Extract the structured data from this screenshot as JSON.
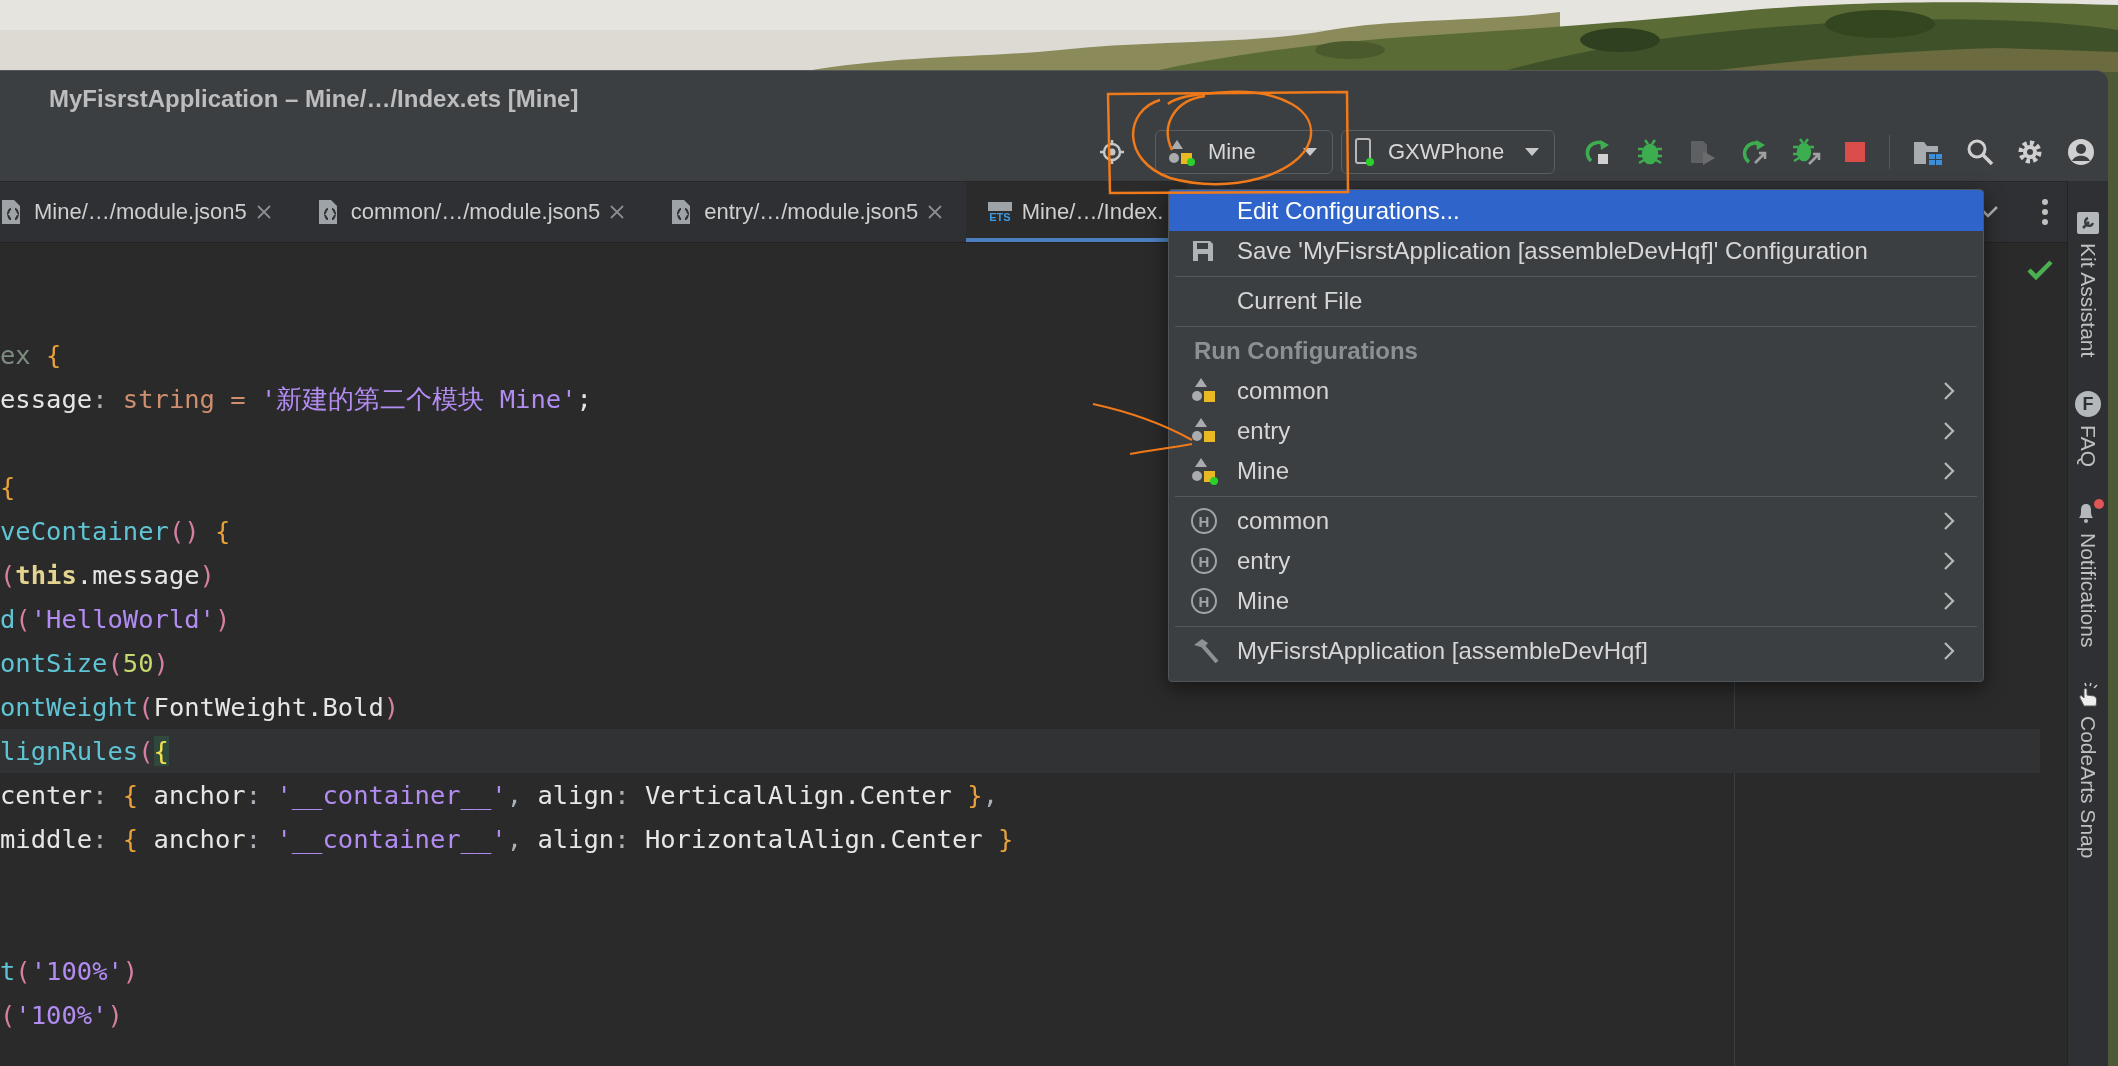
{
  "window": {
    "title": "MyFisrstApplication – Mine/…/Index.ets [Mine]"
  },
  "toolbar": {
    "run_config": {
      "label": "Mine",
      "active": true
    },
    "device": {
      "label": "GXWPhone",
      "connected": true
    },
    "actions": [
      {
        "kind": "run",
        "disabled": false
      },
      {
        "kind": "debug",
        "disabled": false
      },
      {
        "kind": "attach",
        "disabled": true
      },
      {
        "kind": "rerun",
        "disabled": false
      },
      {
        "kind": "profile",
        "disabled": false
      },
      {
        "kind": "stop",
        "disabled": false
      }
    ],
    "tools": [
      {
        "kind": "project"
      },
      {
        "kind": "search"
      },
      {
        "kind": "settings"
      },
      {
        "kind": "account"
      }
    ]
  },
  "tabs": [
    {
      "label": "Mine/…/module.json5",
      "kind": "json",
      "closable": true,
      "selected": false
    },
    {
      "label": "common/…/module.json5",
      "kind": "json",
      "closable": true,
      "selected": false
    },
    {
      "label": "entry/…/module.json5",
      "kind": "json",
      "closable": true,
      "selected": false
    },
    {
      "label": "Mine/…/Index.",
      "kind": "ets",
      "badge": "ETS",
      "closable": false,
      "selected": true
    }
  ],
  "editor": {
    "lines": [
      {
        "kind": "code",
        "current": false,
        "tokens": [
          {
            "text": "ex ",
            "kind": "dim"
          },
          {
            "text": "{",
            "kind": "brace"
          }
        ]
      },
      {
        "kind": "code",
        "current": false,
        "tokens": [
          {
            "text": "essage",
            "kind": "plain"
          },
          {
            "text": ": ",
            "kind": "punct"
          },
          {
            "text": "string ",
            "kind": "keyword"
          },
          {
            "text": "= ",
            "kind": "keyword"
          },
          {
            "text": "'新建的第二个模块 Mine'",
            "kind": "string"
          },
          {
            "text": ";",
            "kind": "plain"
          }
        ]
      },
      {
        "kind": "blank"
      },
      {
        "kind": "code",
        "current": false,
        "tokens": [
          {
            "text": "{",
            "kind": "brace"
          }
        ]
      },
      {
        "kind": "code",
        "current": false,
        "tokens": [
          {
            "text": "veContainer",
            "kind": "func"
          },
          {
            "text": "() ",
            "kind": "paren"
          },
          {
            "text": "{",
            "kind": "brace"
          }
        ]
      },
      {
        "kind": "code",
        "current": false,
        "tokens": [
          {
            "text": "(",
            "kind": "paren"
          },
          {
            "text": "this",
            "kind": "this"
          },
          {
            "text": ".message",
            "kind": "plain"
          },
          {
            "text": ")",
            "kind": "paren"
          }
        ]
      },
      {
        "kind": "code",
        "current": false,
        "tokens": [
          {
            "text": "d",
            "kind": "func"
          },
          {
            "text": "(",
            "kind": "paren"
          },
          {
            "text": "'HelloWorld'",
            "kind": "string"
          },
          {
            "text": ")",
            "kind": "paren"
          }
        ]
      },
      {
        "kind": "code",
        "current": false,
        "tokens": [
          {
            "text": "ontSize",
            "kind": "func"
          },
          {
            "text": "(",
            "kind": "paren"
          },
          {
            "text": "50",
            "kind": "number"
          },
          {
            "text": ")",
            "kind": "paren"
          }
        ]
      },
      {
        "kind": "code",
        "current": false,
        "tokens": [
          {
            "text": "ontWeight",
            "kind": "func"
          },
          {
            "text": "(",
            "kind": "paren"
          },
          {
            "text": "FontWeight.Bold",
            "kind": "plain"
          },
          {
            "text": ")",
            "kind": "paren"
          }
        ]
      },
      {
        "kind": "code",
        "current": true,
        "tokens": [
          {
            "text": "lignRules",
            "kind": "func"
          },
          {
            "text": "(",
            "kind": "paren"
          },
          {
            "text": "{",
            "kind": "hlbrace"
          }
        ]
      },
      {
        "kind": "code",
        "current": false,
        "tokens": [
          {
            "text": "center",
            "kind": "plain"
          },
          {
            "text": ": ",
            "kind": "punct"
          },
          {
            "text": "{",
            "kind": "brace"
          },
          {
            "text": " anchor",
            "kind": "plain"
          },
          {
            "text": ": ",
            "kind": "punct"
          },
          {
            "text": "'__container__'",
            "kind": "string"
          },
          {
            "text": ", ",
            "kind": "punct"
          },
          {
            "text": "align",
            "kind": "plain"
          },
          {
            "text": ": ",
            "kind": "punct"
          },
          {
            "text": "VerticalAlign.Center ",
            "kind": "plain"
          },
          {
            "text": "}",
            "kind": "brace"
          },
          {
            "text": ",",
            "kind": "punct"
          }
        ]
      },
      {
        "kind": "code",
        "current": false,
        "tokens": [
          {
            "text": "middle",
            "kind": "plain"
          },
          {
            "text": ": ",
            "kind": "punct"
          },
          {
            "text": "{",
            "kind": "brace"
          },
          {
            "text": " anchor",
            "kind": "plain"
          },
          {
            "text": ": ",
            "kind": "punct"
          },
          {
            "text": "'__container__'",
            "kind": "string"
          },
          {
            "text": ", ",
            "kind": "punct"
          },
          {
            "text": "align",
            "kind": "plain"
          },
          {
            "text": ": ",
            "kind": "punct"
          },
          {
            "text": "HorizontalAlign.Center ",
            "kind": "plain"
          },
          {
            "text": "}",
            "kind": "brace"
          }
        ]
      },
      {
        "kind": "blank"
      },
      {
        "kind": "blank"
      },
      {
        "kind": "code",
        "current": false,
        "tokens": [
          {
            "text": "t",
            "kind": "func"
          },
          {
            "text": "(",
            "kind": "paren"
          },
          {
            "text": "'100%'",
            "kind": "string"
          },
          {
            "text": ")",
            "kind": "paren"
          }
        ]
      },
      {
        "kind": "code",
        "current": false,
        "tokens": [
          {
            "text": "(",
            "kind": "paren"
          },
          {
            "text": "'100%'",
            "kind": "string"
          },
          {
            "text": ")",
            "kind": "paren"
          }
        ]
      }
    ]
  },
  "menu": {
    "sections": [
      {
        "items": [
          {
            "label": "Edit Configurations...",
            "kind": "plain",
            "selected": true,
            "submenu": false
          },
          {
            "label": "Save 'MyFisrstApplication [assembleDevHqf]' Configuration",
            "kind": "save",
            "selected": false,
            "submenu": false
          }
        ]
      },
      {
        "items": [
          {
            "label": "Current File",
            "kind": "plain",
            "selected": false,
            "submenu": false
          }
        ]
      },
      {
        "header": "Run Configurations",
        "items": [
          {
            "label": "common",
            "kind": "module",
            "active": false,
            "selected": false,
            "submenu": true
          },
          {
            "label": "entry",
            "kind": "module",
            "active": false,
            "selected": false,
            "submenu": true
          },
          {
            "label": "Mine",
            "kind": "module",
            "active": true,
            "selected": false,
            "submenu": true
          }
        ]
      },
      {
        "items": [
          {
            "label": "common",
            "kind": "hvigor",
            "icon_letter": "H",
            "selected": false,
            "submenu": true
          },
          {
            "label": "entry",
            "kind": "hvigor",
            "icon_letter": "H",
            "selected": false,
            "submenu": true
          },
          {
            "label": "Mine",
            "kind": "hvigor",
            "icon_letter": "H",
            "selected": false,
            "submenu": true
          }
        ]
      },
      {
        "items": [
          {
            "label": "MyFisrstApplication [assembleDevHqf]",
            "kind": "task",
            "selected": false,
            "submenu": true
          }
        ]
      }
    ]
  },
  "sidebar": [
    {
      "label": "Kit Assistant",
      "kind": "kit",
      "alert": false
    },
    {
      "label": "FAQ",
      "kind": "letter",
      "icon_letter": "F",
      "alert": false
    },
    {
      "label": "Notifications",
      "kind": "bell",
      "alert": true
    },
    {
      "label": "CodeArts Snap",
      "kind": "snap",
      "alert": false
    }
  ]
}
